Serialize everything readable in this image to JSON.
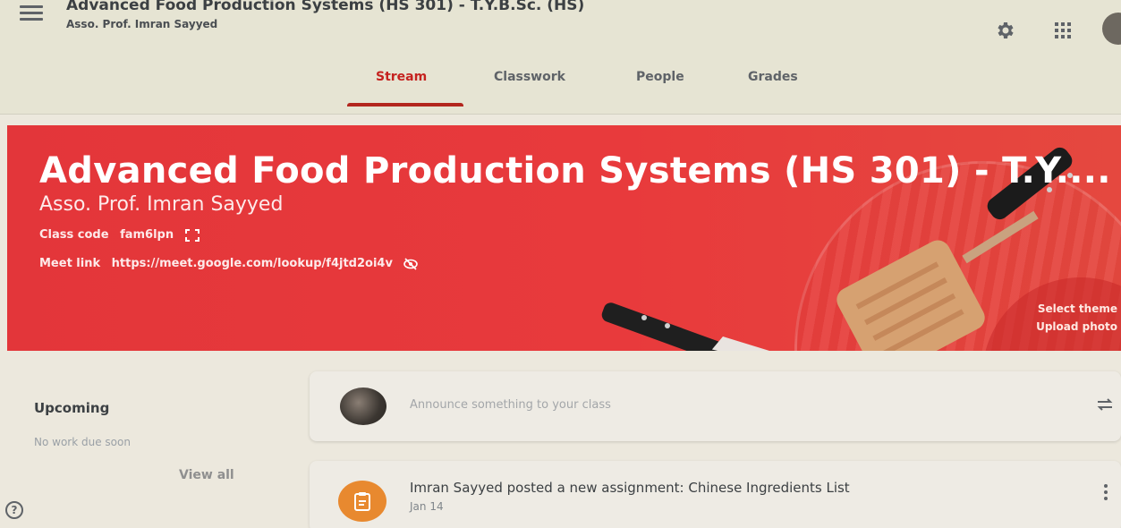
{
  "header": {
    "title": "Advanced Food Production Systems (HS 301) - T.Y.B.Sc. (HS)",
    "subtitle": "Asso. Prof. Imran Sayyed",
    "icons": [
      "menu-icon",
      "gear-icon",
      "apps-grid-icon",
      "account-avatar"
    ]
  },
  "tabs": [
    {
      "label": "Stream",
      "active": true
    },
    {
      "label": "Classwork",
      "active": false
    },
    {
      "label": "People",
      "active": false
    },
    {
      "label": "Grades",
      "active": false
    }
  ],
  "banner": {
    "title": "Advanced Food Production Systems (HS 301) - T.Y....",
    "teacher": "Asso. Prof. Imran Sayyed",
    "class_code_label": "Class code",
    "class_code": "fam6lpn",
    "meet_link_label": "Meet link",
    "meet_link": "https://meet.google.com/lookup/f4jtd2oi4v",
    "select_theme": "Select theme",
    "upload_photo": "Upload photo",
    "color": "#e3363a"
  },
  "upcoming": {
    "title": "Upcoming",
    "empty_text": "No work due soon",
    "view_all": "View all"
  },
  "announce": {
    "placeholder": "Announce something to your class"
  },
  "posts": [
    {
      "text": "Imran Sayyed posted a new assignment: Chinese Ingredients List",
      "date": "Jan 14",
      "icon": "assignment-icon"
    }
  ],
  "colors": {
    "accent": "#c5221f",
    "assignment_icon_bg": "#e8892f"
  }
}
